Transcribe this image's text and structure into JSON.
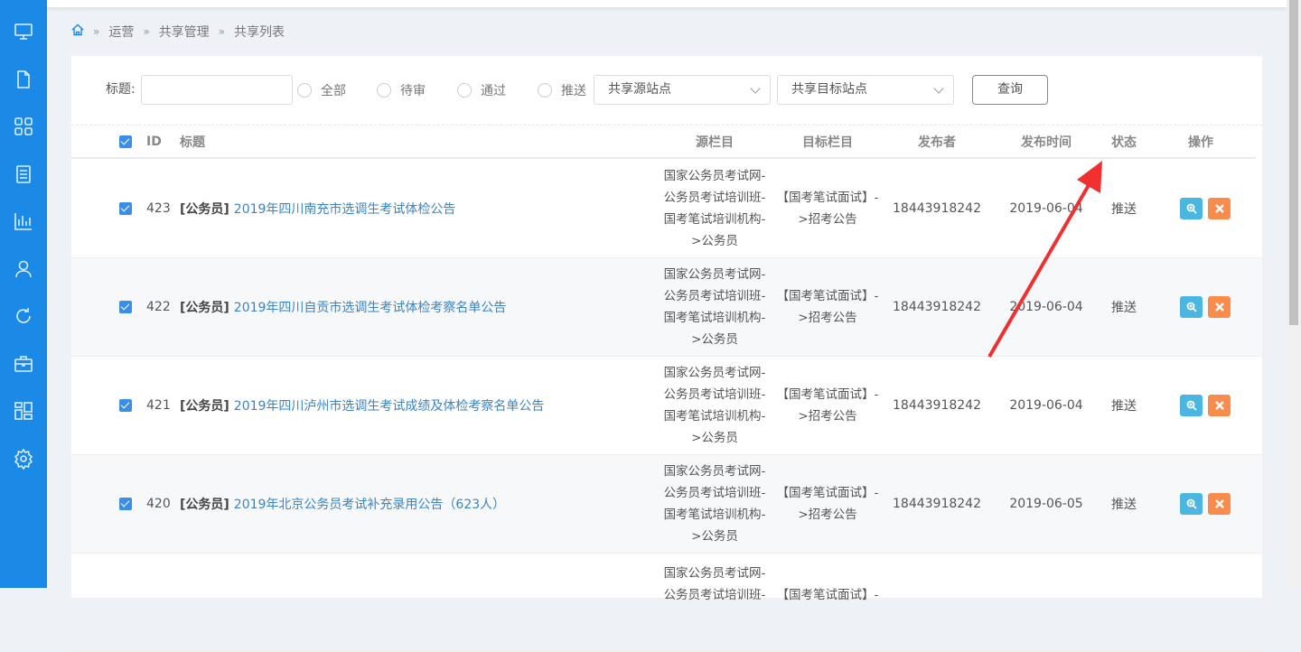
{
  "breadcrumb": [
    "运营",
    "共享管理",
    "共享列表"
  ],
  "sidebar": {
    "icons": [
      "monitor-icon",
      "file-icon",
      "grid-icon",
      "document-icon",
      "chart-icon",
      "user-icon",
      "refresh-icon",
      "box-icon",
      "dashboard-icon",
      "gear-icon"
    ]
  },
  "filter": {
    "title_label": "标题:",
    "title_value": "",
    "radios": [
      "全部",
      "待审",
      "通过",
      "推送"
    ],
    "source_site": "共享源站点",
    "target_site": "共享目标站点",
    "query": "查询"
  },
  "table": {
    "headers": {
      "id": "ID",
      "title": "标题",
      "src": "源栏目",
      "tgt": "目标栏目",
      "pub": "发布者",
      "time": "发布时间",
      "status": "状态",
      "op": "操作"
    },
    "rows": [
      {
        "id": "423",
        "tag": "[公务员]",
        "title": "2019年四川南充市选调生考试体检公告",
        "src": [
          "国家公务员考试网-",
          "公务员考试培训班-",
          "国考笔试培训机构-",
          ">公务员"
        ],
        "tgt": [
          "【国考笔试面试】-",
          ">招考公告"
        ],
        "pub": "18443918242",
        "time": "2019-06-04",
        "status": "推送"
      },
      {
        "id": "422",
        "tag": "[公务员]",
        "title": "2019年四川自贡市选调生考试体检考察名单公告",
        "src": [
          "国家公务员考试网-",
          "公务员考试培训班-",
          "国考笔试培训机构-",
          ">公务员"
        ],
        "tgt": [
          "【国考笔试面试】-",
          ">招考公告"
        ],
        "pub": "18443918242",
        "time": "2019-06-04",
        "status": "推送"
      },
      {
        "id": "421",
        "tag": "[公务员]",
        "title": "2019年四川泸州市选调生考试成绩及体检考察名单公告",
        "src": [
          "国家公务员考试网-",
          "公务员考试培训班-",
          "国考笔试培训机构-",
          ">公务员"
        ],
        "tgt": [
          "【国考笔试面试】-",
          ">招考公告"
        ],
        "pub": "18443918242",
        "time": "2019-06-04",
        "status": "推送"
      },
      {
        "id": "420",
        "tag": "[公务员]",
        "title": "2019年北京公务员考试补充录用公告（623人）",
        "src": [
          "国家公务员考试网-",
          "公务员考试培训班-",
          "国考笔试培训机构-",
          ">公务员"
        ],
        "tgt": [
          "【国考笔试面试】-",
          ">招考公告"
        ],
        "pub": "18443918242",
        "time": "2019-06-05",
        "status": "推送"
      },
      {
        "id": "",
        "tag": "",
        "title": "",
        "src": [
          "国家公务员考试网-",
          "公务员考试培训班-"
        ],
        "tgt": [
          "【国考笔试面试】-"
        ],
        "pub": "",
        "time": "",
        "status": ""
      }
    ]
  },
  "colors": {
    "sidebar": "#1a8ae6",
    "view": "#4bb6e0",
    "delete": "#f88c4c",
    "arrow": "#f03030"
  }
}
